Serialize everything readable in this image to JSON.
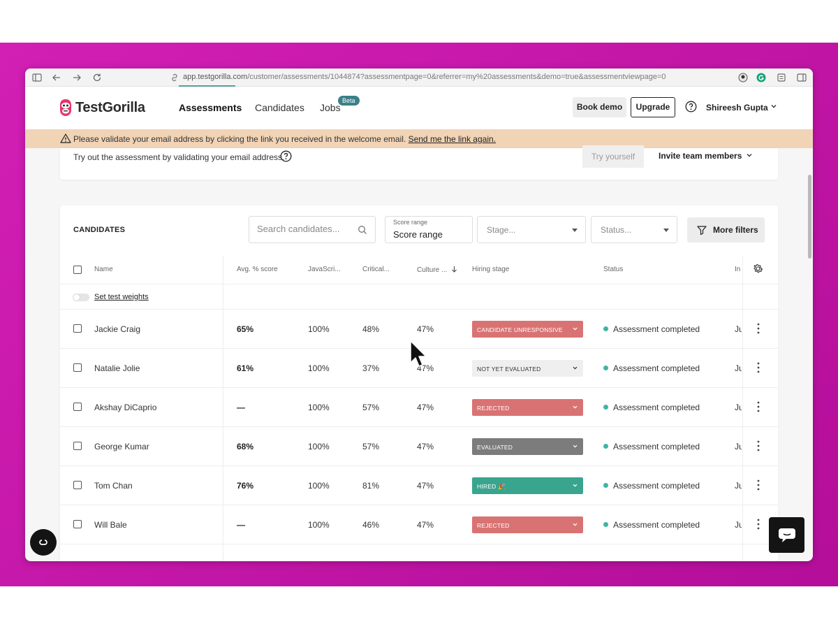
{
  "browser": {
    "url_host": "app.testgorilla.com",
    "url_path": "/customer/assessments/1044874?assessmentpage=0&referrer=my%20assessments&demo=true&assessmentviewpage=0"
  },
  "header": {
    "brand": "TestGorilla",
    "nav": [
      "Assessments",
      "Candidates",
      "Jobs"
    ],
    "beta_badge": "Beta",
    "book_demo": "Book demo",
    "upgrade": "Upgrade",
    "user": "Shireesh Gupta"
  },
  "warning": {
    "text": "Please validate your email address by clicking the link you received in the welcome email.",
    "link": "Send me the link again."
  },
  "assessment": {
    "try_text": "Try out the assessment by validating your email address.",
    "try_button": "Try yourself",
    "invite_button": "Invite team members"
  },
  "candidates": {
    "title": "CANDIDATES",
    "search_placeholder": "Search candidates...",
    "score_range_label": "Score range",
    "score_range_value": "Score range",
    "stage_placeholder": "Stage...",
    "status_placeholder": "Status...",
    "more_filters": "More filters",
    "set_test_weights": "Set test weights",
    "columns": [
      "Name",
      "Avg. % score",
      "JavaScri...",
      "Critical...",
      "Culture ...",
      "Hiring stage",
      "Status",
      "In"
    ],
    "rows": [
      {
        "name": "Jackie Craig",
        "avg": "65%",
        "js": "100%",
        "critical": "48%",
        "culture": "47%",
        "stage": "CANDIDATE UNRESPONSIVE",
        "stage_color": "#d97373",
        "stage_text_color": "#ffffff",
        "status": "Assessment completed",
        "inv": "Ju"
      },
      {
        "name": "Natalie Jolie",
        "avg": "61%",
        "js": "100%",
        "critical": "37%",
        "culture": "47%",
        "stage": "NOT YET EVALUATED",
        "stage_color": "#efefef",
        "stage_text_color": "#333333",
        "status": "Assessment completed",
        "inv": "Ju"
      },
      {
        "name": "Akshay DiCaprio",
        "avg": "—",
        "js": "100%",
        "critical": "57%",
        "culture": "47%",
        "stage": "REJECTED",
        "stage_color": "#d97373",
        "stage_text_color": "#ffffff",
        "status": "Assessment completed",
        "inv": "Ju"
      },
      {
        "name": "George Kumar",
        "avg": "68%",
        "js": "100%",
        "critical": "57%",
        "culture": "47%",
        "stage": "EVALUATED",
        "stage_color": "#7c7c7c",
        "stage_text_color": "#ffffff",
        "status": "Assessment completed",
        "inv": "Ju"
      },
      {
        "name": "Tom Chan",
        "avg": "76%",
        "js": "100%",
        "critical": "81%",
        "culture": "47%",
        "stage": "HIRED 🎉",
        "stage_color": "#3aa58f",
        "stage_text_color": "#ffffff",
        "status": "Assessment completed",
        "inv": "Ju"
      },
      {
        "name": "Will Bale",
        "avg": "—",
        "js": "100%",
        "critical": "46%",
        "culture": "47%",
        "stage": "REJECTED",
        "stage_color": "#d97373",
        "stage_text_color": "#ffffff",
        "status": "Assessment completed",
        "inv": "Ju"
      }
    ]
  },
  "colors": {
    "background_band": "#c8169f",
    "status_dot": "#3eb5a3",
    "accent": "#3c7f88"
  }
}
